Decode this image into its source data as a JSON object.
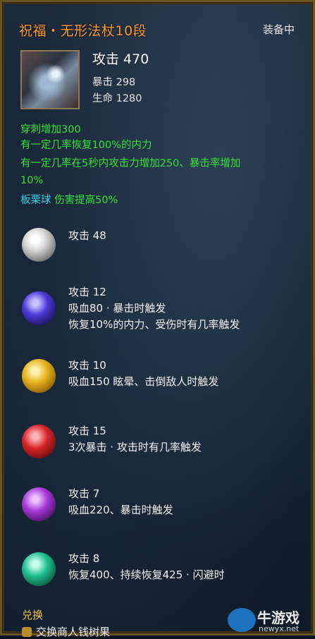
{
  "item": {
    "title": "祝福・无形法杖10段",
    "status": "装备中",
    "attack": "攻击 470",
    "stats": [
      "暴击 298",
      "生命 1280"
    ]
  },
  "bonuses": [
    {
      "text": "穿刺增加300"
    },
    {
      "text": "有一定几率恢复100%的内力"
    },
    {
      "text": "有一定几率在5秒内攻击力增加250、暴击率增加"
    },
    {
      "text": "10%"
    }
  ],
  "set_bonus": {
    "label": "板栗球",
    "text": "伤害提高50%"
  },
  "gems": [
    {
      "color": "#d9d9d9",
      "icon": "white-gem-icon",
      "lines": [
        "攻击 48"
      ]
    },
    {
      "color": "#4b3ad9",
      "icon": "blue-gem-icon",
      "lines": [
        "攻击 12",
        "吸血80 · 暴击时触发",
        "恢复10%的内力、受伤时有几率触发"
      ]
    },
    {
      "color": "#e7b21c",
      "icon": "yellow-gem-icon",
      "lines": [
        "攻击 10",
        "吸血150 眩晕、击倒敌人时触发"
      ]
    },
    {
      "color": "#d8262a",
      "icon": "red-gem-icon",
      "lines": [
        "攻击 15",
        "3次暴击 · 攻击时有几率触发"
      ]
    },
    {
      "color": "#a63ad8",
      "icon": "purple-gem-icon",
      "lines": [
        "攻击 7",
        "吸血220、暴击时触发"
      ]
    },
    {
      "color": "#1fbf8f",
      "icon": "green-gem-icon",
      "lines": [
        "攻击 8",
        "恢复400、持续恢复425 · 闪避时"
      ]
    }
  ],
  "exchange": {
    "label": "兑换",
    "item": "交换商人钱树果"
  },
  "watermark": {
    "text": "牛游戏",
    "sub": "newyx.net"
  }
}
